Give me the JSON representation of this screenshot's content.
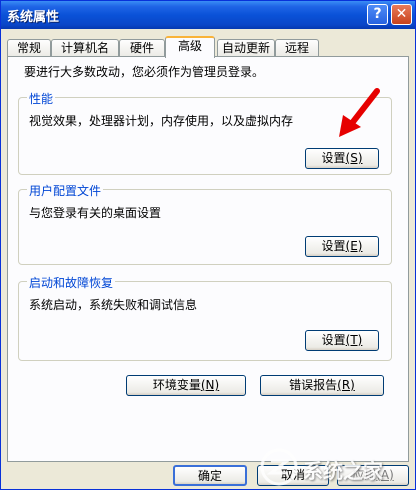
{
  "window": {
    "title": "系统属性",
    "help_label": "?",
    "close_label": "✕"
  },
  "tabs": [
    {
      "label": "常规"
    },
    {
      "label": "计算机名"
    },
    {
      "label": "硬件"
    },
    {
      "label": "高级"
    },
    {
      "label": "自动更新"
    },
    {
      "label": "远程"
    }
  ],
  "active_tab": "高级",
  "panel": {
    "note": "要进行大多数改动，您必须作为管理员登录。",
    "performance": {
      "title": "性能",
      "desc": "视觉效果，处理器计划，内存使用，以及虚拟内存",
      "button": "设置",
      "hotkey": "(S)"
    },
    "profiles": {
      "title": "用户配置文件",
      "desc": "与您登录有关的桌面设置",
      "button": "设置",
      "hotkey": "(E)"
    },
    "startup": {
      "title": "启动和故障恢复",
      "desc": "系统启动，系统失败和调试信息",
      "button": "设置",
      "hotkey": "(T)"
    },
    "env_button": "环境变量",
    "env_hotkey": "(N)",
    "error_button": "错误报告",
    "error_hotkey": "(R)"
  },
  "footer": {
    "ok": "确定",
    "cancel": "取消",
    "apply": "应用",
    "apply_hotkey": "(A)"
  },
  "watermark": {
    "text": "系统之家"
  },
  "colors": {
    "accent": "#0046d5",
    "arrow": "#e60000",
    "title_bar": "#0a52d8"
  }
}
